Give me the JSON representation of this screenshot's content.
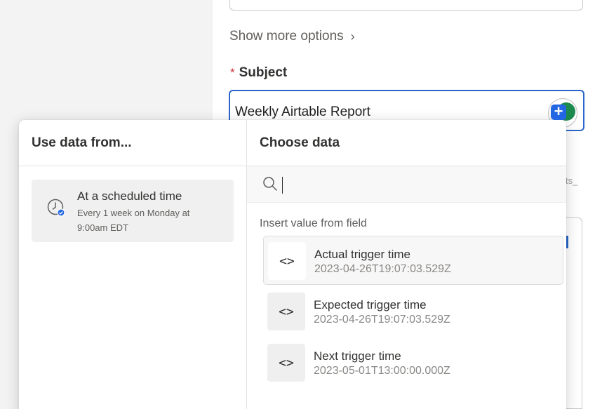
{
  "form": {
    "show_more_label": "Show more options",
    "subject_required_mark": "*",
    "subject_label": "Subject",
    "subject_value": "Weekly Airtable Report",
    "right_partial_text": "ts_"
  },
  "picker": {
    "left_header": "Use data from...",
    "right_header": "Choose data",
    "source": {
      "title": "At a scheduled time",
      "subtitle": "Every 1 week on Monday at 9:00am EDT",
      "icon": "clock-icon"
    },
    "search": {
      "placeholder": "",
      "icon": "search-icon"
    },
    "section_label": "Insert value from field",
    "fields": [
      {
        "name": "Actual trigger time",
        "value": "2023-04-26T19:07:03.529Z",
        "icon": "code-icon"
      },
      {
        "name": "Expected trigger time",
        "value": "2023-04-26T19:07:03.529Z",
        "icon": "code-icon"
      },
      {
        "name": "Next trigger time",
        "value": "2023-05-01T13:00:00.000Z",
        "icon": "code-icon"
      }
    ]
  },
  "colors": {
    "accent": "#2a67c8",
    "required": "#d13438"
  }
}
